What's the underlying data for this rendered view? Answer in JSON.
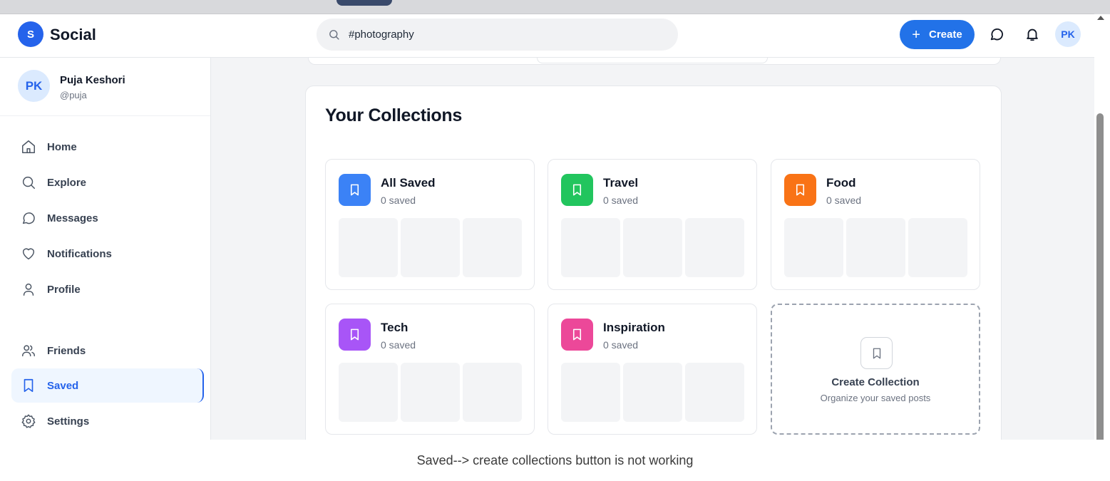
{
  "app": {
    "logo_letter": "S",
    "name": "Social"
  },
  "search": {
    "value": "#photography",
    "icon": "search-icon"
  },
  "header": {
    "create_label": "Create",
    "avatar_initials": "PK"
  },
  "user": {
    "initials": "PK",
    "name": "Puja Keshori",
    "handle": "@puja"
  },
  "nav": {
    "home": "Home",
    "explore": "Explore",
    "messages": "Messages",
    "notifications": "Notifications",
    "profile": "Profile",
    "friends": "Friends",
    "saved": "Saved",
    "settings": "Settings"
  },
  "main": {
    "title": "Your Collections",
    "collections": [
      {
        "name": "All Saved",
        "count": "0 saved",
        "color": "#3b82f6"
      },
      {
        "name": "Travel",
        "count": "0 saved",
        "color": "#22c55e"
      },
      {
        "name": "Food",
        "count": "0 saved",
        "color": "#f97316"
      },
      {
        "name": "Tech",
        "count": "0 saved",
        "color": "#a855f7"
      },
      {
        "name": "Inspiration",
        "count": "0 saved",
        "color": "#ec4899"
      }
    ],
    "create": {
      "title": "Create Collection",
      "subtitle": "Organize your saved posts"
    }
  },
  "caption": "Saved--> create collections button is not working",
  "colors": {
    "accent": "#2563eb",
    "active_bg": "#eff6ff"
  }
}
